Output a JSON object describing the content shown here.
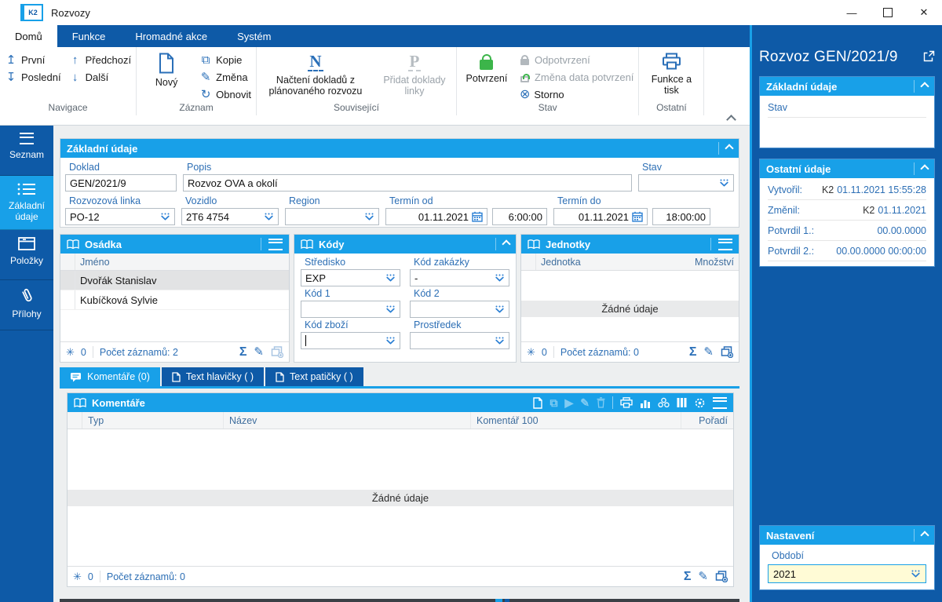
{
  "window": {
    "title": "Rozvozy",
    "logo": "K2"
  },
  "ribbon": {
    "tabs": [
      {
        "label": "Domů",
        "active": true
      },
      {
        "label": "Funkce",
        "active": false
      },
      {
        "label": "Hromadné akce",
        "active": false
      },
      {
        "label": "Systém",
        "active": false
      }
    ],
    "navigace": {
      "label": "Navigace",
      "prvni": "První",
      "posledni": "Poslední",
      "predchozi": "Předchozí",
      "dalsi": "Další"
    },
    "zaznam": {
      "label": "Záznam",
      "novy": "Nový",
      "kopie": "Kopie",
      "zmena": "Změna",
      "obnovit": "Obnovit"
    },
    "souvisejici": {
      "label": "Související",
      "nacteni": "Načtení dokladů z plánovaného rozvozu",
      "pridat": "Přidat doklady linky"
    },
    "stav": {
      "label": "Stav",
      "potvrzeni": "Potvrzení",
      "odpotvrzeni": "Odpotvrzení",
      "zmena_data": "Změna data potvrzení",
      "storno": "Storno"
    },
    "ostatni": {
      "label": "Ostatní",
      "funkce_tisk": "Funkce a tisk"
    }
  },
  "sidebar": {
    "items": [
      {
        "label": "Seznam",
        "active": false
      },
      {
        "label": "Základní údaje",
        "active": true
      },
      {
        "label": "Položky",
        "active": false
      },
      {
        "label": "Přílohy",
        "active": false
      }
    ]
  },
  "form": {
    "title": "Základní údaje",
    "doklad_label": "Doklad",
    "doklad": "GEN/2021/9",
    "popis_label": "Popis",
    "popis": "Rozvoz OVA a okolí",
    "stav_label": "Stav",
    "stav": "",
    "linka_label": "Rozvozová linka",
    "linka": "PO-12",
    "vozidlo_label": "Vozidlo",
    "vozidlo": "2T6 4754",
    "region_label": "Region",
    "region": "",
    "termin_od_label": "Termín od",
    "termin_od_datum": "01.11.2021",
    "termin_od_cas": "6:00:00",
    "termin_do_label": "Termín do",
    "termin_do_datum": "01.11.2021",
    "termin_do_cas": "18:00:00"
  },
  "osadka": {
    "title": "Osádka",
    "col": "Jméno",
    "rows": [
      {
        "name": "Dvořák Stanislav"
      },
      {
        "name": "Kubíčková Sylvie"
      }
    ],
    "star_count": "0",
    "count": "Počet záznamů: 2"
  },
  "kody": {
    "title": "Kódy",
    "stredisko_label": "Středisko",
    "stredisko": "EXP",
    "zakazka_label": "Kód zakázky",
    "zakazka": "-",
    "kod1_label": "Kód 1",
    "kod1": "",
    "kod2_label": "Kód 2",
    "kod2": "",
    "zbozi_label": "Kód zboží",
    "zbozi": "",
    "prostredek_label": "Prostředek",
    "prostredek": ""
  },
  "jednotky": {
    "title": "Jednotky",
    "col1": "Jednotka",
    "col2": "Množství",
    "empty": "Žádné údaje",
    "star_count": "0",
    "count": "Počet záznamů: 0"
  },
  "tabs": {
    "komentare": "Komentáře (0)",
    "hlavicka": "Text hlavičky ( )",
    "paticka": "Text patičky ( )"
  },
  "komentare": {
    "title": "Komentáře",
    "cols": [
      "Typ",
      "Název",
      "Komentář 100",
      "Pořadí"
    ],
    "empty": "Žádné údaje",
    "star_count": "0",
    "count": "Počet záznamů: 0"
  },
  "right": {
    "title": "Rozvoz GEN/2021/9",
    "zakladni": {
      "title": "Základní údaje",
      "stav_label": "Stav"
    },
    "ostatni": {
      "title": "Ostatní údaje",
      "rows": [
        {
          "label": "Vytvořil:",
          "prefix": "K2",
          "value": "01.11.2021 15:55:28"
        },
        {
          "label": "Změnil:",
          "prefix": "K2",
          "value": "01.11.2021"
        },
        {
          "label": "Potvrdil 1.:",
          "prefix": "",
          "value": "00.00.0000"
        },
        {
          "label": "Potvrdil 2.:",
          "prefix": "",
          "value": "00.00.0000 00:00:00"
        }
      ]
    },
    "nastaveni": {
      "title": "Nastavení",
      "obdobi_label": "Období",
      "obdobi": "2021"
    }
  },
  "colors": {
    "dark_blue": "#0e5aa7",
    "accent": "#18a0e8",
    "confirm_green": "#3cb54a",
    "field_label": "#2d6fb5",
    "period_bg": "#fffbd6"
  }
}
